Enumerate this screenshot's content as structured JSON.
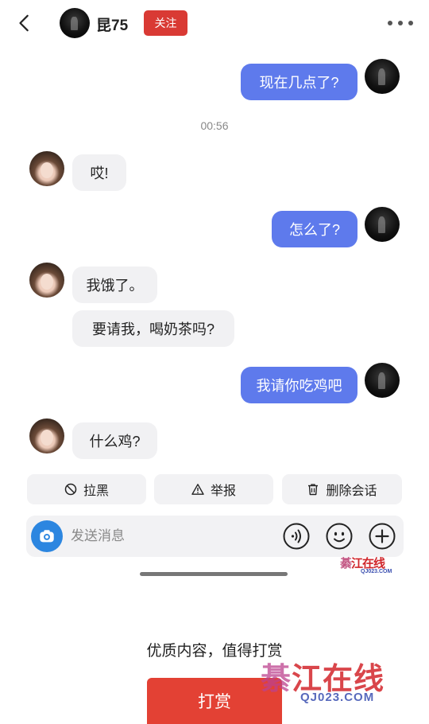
{
  "header": {
    "contact_name": "昆75",
    "follow_label": "关注"
  },
  "messages": [
    {
      "from": "me",
      "text": "现在几点了?"
    },
    {
      "from": "timestamp",
      "text": "00:56"
    },
    {
      "from": "them",
      "text": "哎!"
    },
    {
      "from": "me",
      "text": "怎么了?"
    },
    {
      "from": "them",
      "text": "我饿了。"
    },
    {
      "from": "them",
      "text": "要请我，喝奶茶吗?"
    },
    {
      "from": "me",
      "text": "我请你吃鸡吧"
    },
    {
      "from": "them",
      "text": "什么鸡?"
    }
  ],
  "actions": {
    "block_label": "拉黑",
    "report_label": "举报",
    "delete_label": "删除会话"
  },
  "input": {
    "placeholder": "发送消息"
  },
  "reward": {
    "prompt": "优质内容，值得打赏",
    "button_label": "打赏"
  },
  "watermark": {
    "prefix": "綦",
    "name": "江在线",
    "url": "QJ023.COM"
  },
  "colors": {
    "my_bubble": "#5e7aec",
    "their_bubble": "#f1f1f3",
    "follow_button": "#d93a34",
    "reward_button": "#e34134",
    "camera_button": "#2c86e0"
  },
  "icons": {
    "back": "chevron-left-icon",
    "more": "more-dots-icon",
    "block": "prohibit-icon",
    "report": "warning-triangle-icon",
    "delete": "trash-icon",
    "camera": "camera-icon",
    "voice": "voice-icon",
    "emoji": "emoji-icon",
    "add": "plus-icon"
  }
}
